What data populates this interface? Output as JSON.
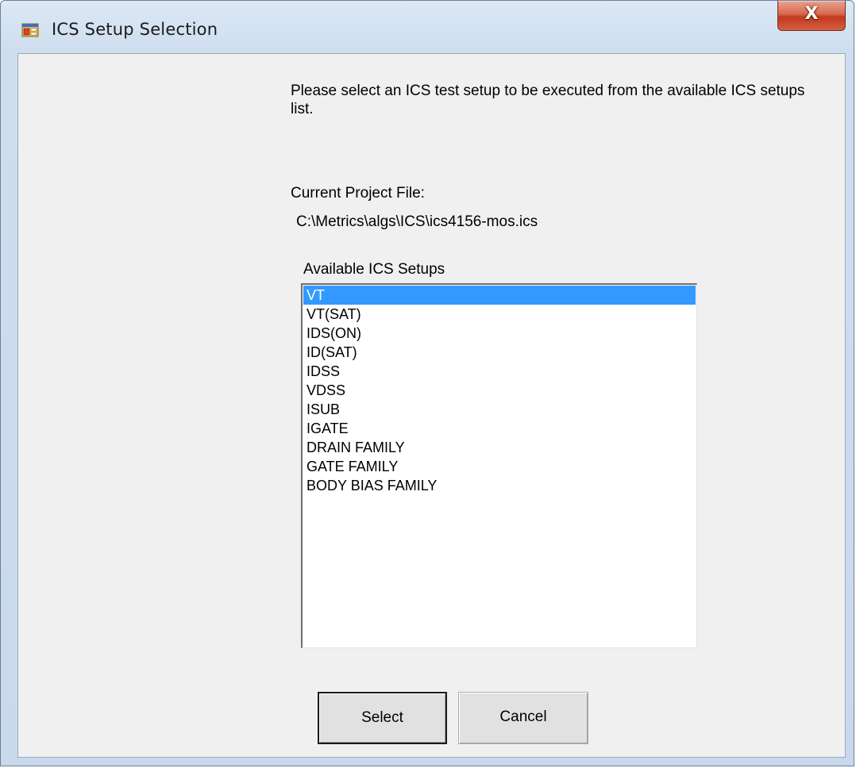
{
  "window": {
    "title": "ICS Setup Selection",
    "close_glyph": "X",
    "icon": "app-form-icon"
  },
  "dialog": {
    "instructions": "Please select an ICS test setup to be executed from the available ICS setups list.",
    "current_project_label": "Current Project File:",
    "current_project_path": "C:\\Metrics\\algs\\ICS\\ics4156-mos.ics",
    "available_label": "Available ICS Setups"
  },
  "setups_list": {
    "items": [
      "VT",
      "VT(SAT)",
      "IDS(ON)",
      "ID(SAT)",
      "IDSS",
      "VDSS",
      "ISUB",
      "IGATE",
      "DRAIN FAMILY",
      "GATE FAMILY",
      "BODY BIAS FAMILY"
    ],
    "selected": "VT"
  },
  "buttons": {
    "select_label": "Select",
    "cancel_label": "Cancel"
  },
  "colors": {
    "selection": "#3399ff",
    "client_bg": "#f0f0f0",
    "close_button": "#c2391d"
  }
}
